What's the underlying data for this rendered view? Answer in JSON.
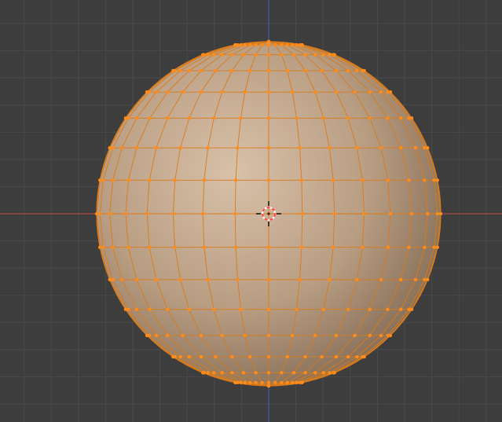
{
  "viewport": {
    "view": "front-orthographic",
    "mode": "edit-mode",
    "background_color": "#3d3d3d",
    "grid_color": "#4a4a4a",
    "x_axis_color": "#c24a4a",
    "z_axis_color": "#3f68b0"
  },
  "mesh": {
    "type": "uv-sphere",
    "selection": "all-selected",
    "segments": 32,
    "rings": 16,
    "surface_color": "#c5a688",
    "edge_color": "#d97a1a",
    "vertex_color": "#ff8c1a"
  },
  "cursor_3d": {
    "icon": "3d-cursor-icon",
    "ring_color_a": "#ff4a4a",
    "ring_color_b": "#ffffff"
  }
}
